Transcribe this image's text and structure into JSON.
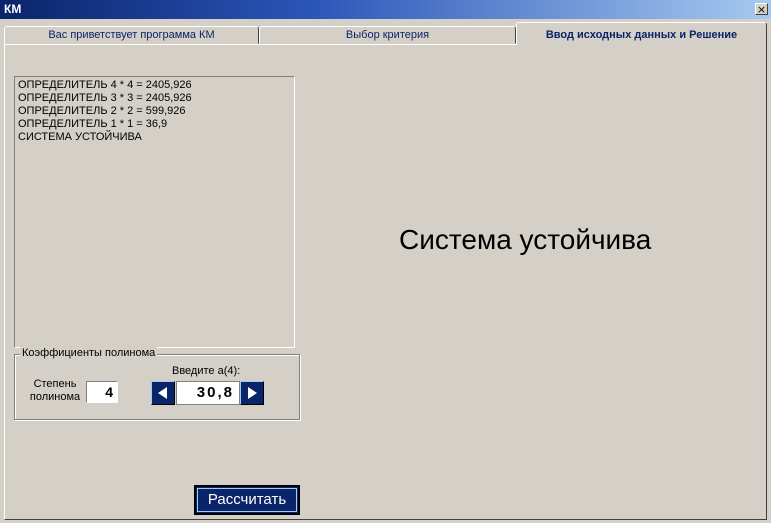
{
  "window": {
    "title": "КМ",
    "close_glyph": "×"
  },
  "tabs": [
    {
      "label": "Вас приветствует программа КМ",
      "active": false
    },
    {
      "label": "Выбор критерия",
      "active": false
    },
    {
      "label": "Ввод исходных данных и Решение",
      "active": true
    }
  ],
  "log": {
    "lines": [
      "ОПРЕДЕЛИТЕЛЬ 4 * 4 = 2405,926",
      "ОПРЕДЕЛИТЕЛЬ 3 * 3 = 2405,926",
      "ОПРЕДЕЛИТЕЛЬ 2 * 2 = 599,926",
      "ОПРЕДЕЛИТЕЛЬ 1 * 1 = 36,9",
      "СИСТЕМА УСТОЙЧИВА"
    ]
  },
  "coeffs": {
    "group_label": "Коэффициенты полинома",
    "degree_label": "Степень полинома",
    "degree_value": "4",
    "enter_label": "Введите а(4):",
    "value": "30,8"
  },
  "result_text": "Система устойчива",
  "calc_button": "Рассчитать",
  "colors": {
    "button_bg": "#0a246a",
    "window_bg": "#d4d0c8"
  }
}
